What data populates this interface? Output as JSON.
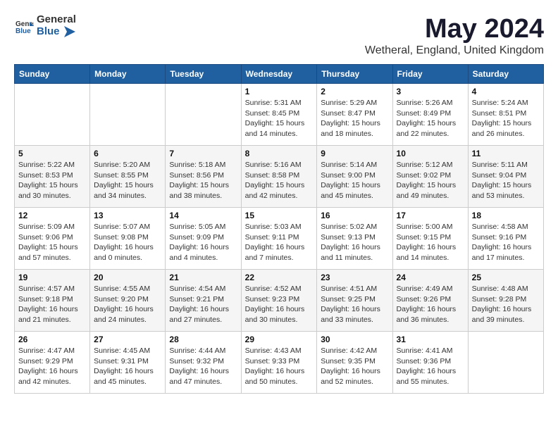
{
  "header": {
    "logo_general": "General",
    "logo_blue": "Blue",
    "title": "May 2024",
    "location": "Wetheral, England, United Kingdom"
  },
  "days_of_week": [
    "Sunday",
    "Monday",
    "Tuesday",
    "Wednesday",
    "Thursday",
    "Friday",
    "Saturday"
  ],
  "weeks": [
    [
      {
        "day": "",
        "info": ""
      },
      {
        "day": "",
        "info": ""
      },
      {
        "day": "",
        "info": ""
      },
      {
        "day": "1",
        "sunrise": "5:31 AM",
        "sunset": "8:45 PM",
        "daylight": "15 hours and 14 minutes."
      },
      {
        "day": "2",
        "sunrise": "5:29 AM",
        "sunset": "8:47 PM",
        "daylight": "15 hours and 18 minutes."
      },
      {
        "day": "3",
        "sunrise": "5:26 AM",
        "sunset": "8:49 PM",
        "daylight": "15 hours and 22 minutes."
      },
      {
        "day": "4",
        "sunrise": "5:24 AM",
        "sunset": "8:51 PM",
        "daylight": "15 hours and 26 minutes."
      }
    ],
    [
      {
        "day": "5",
        "sunrise": "5:22 AM",
        "sunset": "8:53 PM",
        "daylight": "15 hours and 30 minutes."
      },
      {
        "day": "6",
        "sunrise": "5:20 AM",
        "sunset": "8:55 PM",
        "daylight": "15 hours and 34 minutes."
      },
      {
        "day": "7",
        "sunrise": "5:18 AM",
        "sunset": "8:56 PM",
        "daylight": "15 hours and 38 minutes."
      },
      {
        "day": "8",
        "sunrise": "5:16 AM",
        "sunset": "8:58 PM",
        "daylight": "15 hours and 42 minutes."
      },
      {
        "day": "9",
        "sunrise": "5:14 AM",
        "sunset": "9:00 PM",
        "daylight": "15 hours and 45 minutes."
      },
      {
        "day": "10",
        "sunrise": "5:12 AM",
        "sunset": "9:02 PM",
        "daylight": "15 hours and 49 minutes."
      },
      {
        "day": "11",
        "sunrise": "5:11 AM",
        "sunset": "9:04 PM",
        "daylight": "15 hours and 53 minutes."
      }
    ],
    [
      {
        "day": "12",
        "sunrise": "5:09 AM",
        "sunset": "9:06 PM",
        "daylight": "15 hours and 57 minutes."
      },
      {
        "day": "13",
        "sunrise": "5:07 AM",
        "sunset": "9:08 PM",
        "daylight": "16 hours and 0 minutes."
      },
      {
        "day": "14",
        "sunrise": "5:05 AM",
        "sunset": "9:09 PM",
        "daylight": "16 hours and 4 minutes."
      },
      {
        "day": "15",
        "sunrise": "5:03 AM",
        "sunset": "9:11 PM",
        "daylight": "16 hours and 7 minutes."
      },
      {
        "day": "16",
        "sunrise": "5:02 AM",
        "sunset": "9:13 PM",
        "daylight": "16 hours and 11 minutes."
      },
      {
        "day": "17",
        "sunrise": "5:00 AM",
        "sunset": "9:15 PM",
        "daylight": "16 hours and 14 minutes."
      },
      {
        "day": "18",
        "sunrise": "4:58 AM",
        "sunset": "9:16 PM",
        "daylight": "16 hours and 17 minutes."
      }
    ],
    [
      {
        "day": "19",
        "sunrise": "4:57 AM",
        "sunset": "9:18 PM",
        "daylight": "16 hours and 21 minutes."
      },
      {
        "day": "20",
        "sunrise": "4:55 AM",
        "sunset": "9:20 PM",
        "daylight": "16 hours and 24 minutes."
      },
      {
        "day": "21",
        "sunrise": "4:54 AM",
        "sunset": "9:21 PM",
        "daylight": "16 hours and 27 minutes."
      },
      {
        "day": "22",
        "sunrise": "4:52 AM",
        "sunset": "9:23 PM",
        "daylight": "16 hours and 30 minutes."
      },
      {
        "day": "23",
        "sunrise": "4:51 AM",
        "sunset": "9:25 PM",
        "daylight": "16 hours and 33 minutes."
      },
      {
        "day": "24",
        "sunrise": "4:49 AM",
        "sunset": "9:26 PM",
        "daylight": "16 hours and 36 minutes."
      },
      {
        "day": "25",
        "sunrise": "4:48 AM",
        "sunset": "9:28 PM",
        "daylight": "16 hours and 39 minutes."
      }
    ],
    [
      {
        "day": "26",
        "sunrise": "4:47 AM",
        "sunset": "9:29 PM",
        "daylight": "16 hours and 42 minutes."
      },
      {
        "day": "27",
        "sunrise": "4:45 AM",
        "sunset": "9:31 PM",
        "daylight": "16 hours and 45 minutes."
      },
      {
        "day": "28",
        "sunrise": "4:44 AM",
        "sunset": "9:32 PM",
        "daylight": "16 hours and 47 minutes."
      },
      {
        "day": "29",
        "sunrise": "4:43 AM",
        "sunset": "9:33 PM",
        "daylight": "16 hours and 50 minutes."
      },
      {
        "day": "30",
        "sunrise": "4:42 AM",
        "sunset": "9:35 PM",
        "daylight": "16 hours and 52 minutes."
      },
      {
        "day": "31",
        "sunrise": "4:41 AM",
        "sunset": "9:36 PM",
        "daylight": "16 hours and 55 minutes."
      },
      {
        "day": "",
        "info": ""
      }
    ]
  ]
}
